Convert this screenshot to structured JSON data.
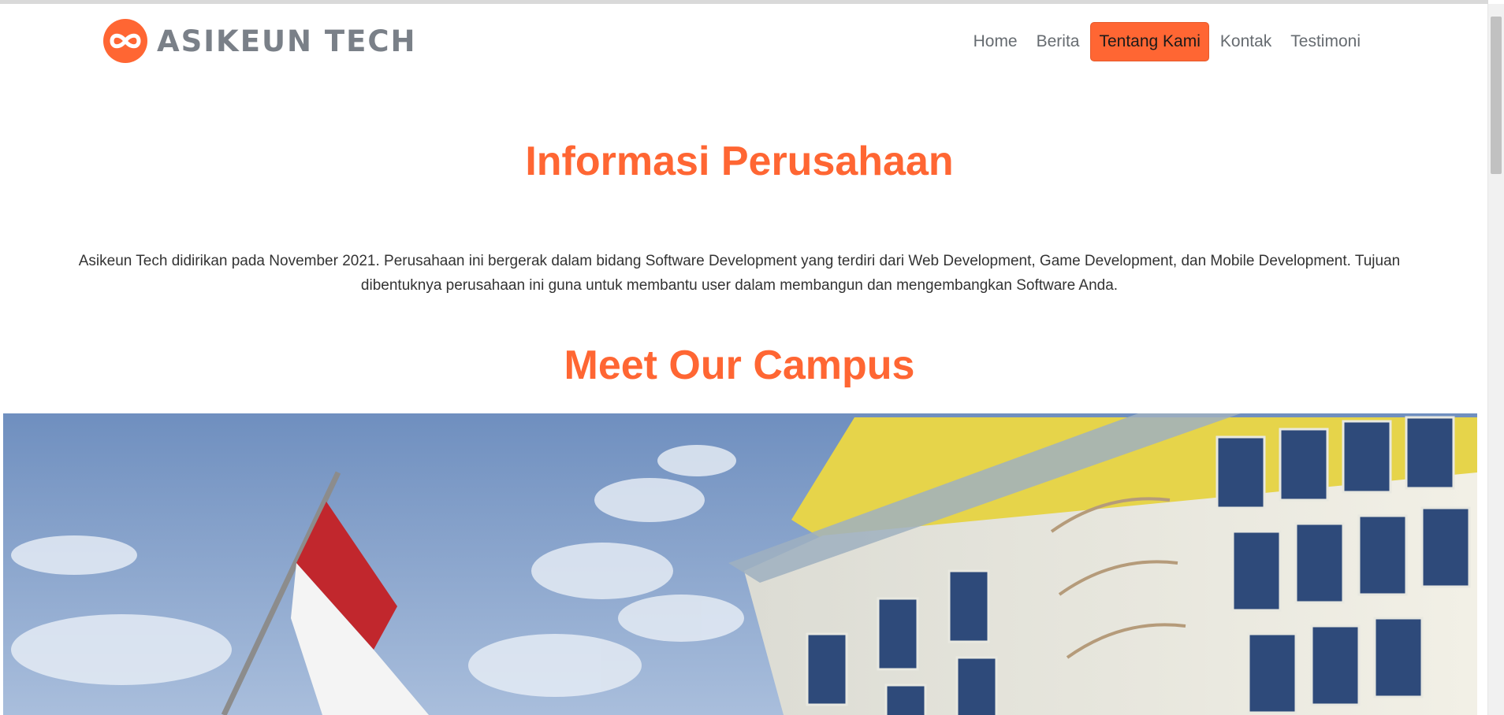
{
  "brand": {
    "name": "ASIKEUN TECH",
    "accent_color": "#ff6633",
    "logo_icon": "infinity-icon"
  },
  "nav": {
    "items": [
      {
        "label": "Home"
      },
      {
        "label": "Berita"
      },
      {
        "label": "Tentang Kami",
        "active": true
      },
      {
        "label": "Kontak"
      },
      {
        "label": "Testimoni"
      }
    ]
  },
  "about": {
    "title": "Informasi Perusahaan",
    "description": "Asikeun Tech didirikan pada November 2021. Perusahaan ini bergerak dalam bidang Software Development yang terdiri dari Web Development, Game Development, dan Mobile Development. Tujuan dibentuknya perusahaan ini guna untuk membantu user dalam membangun dan mengembangkan Software Anda."
  },
  "campus": {
    "title": "Meet Our Campus"
  }
}
